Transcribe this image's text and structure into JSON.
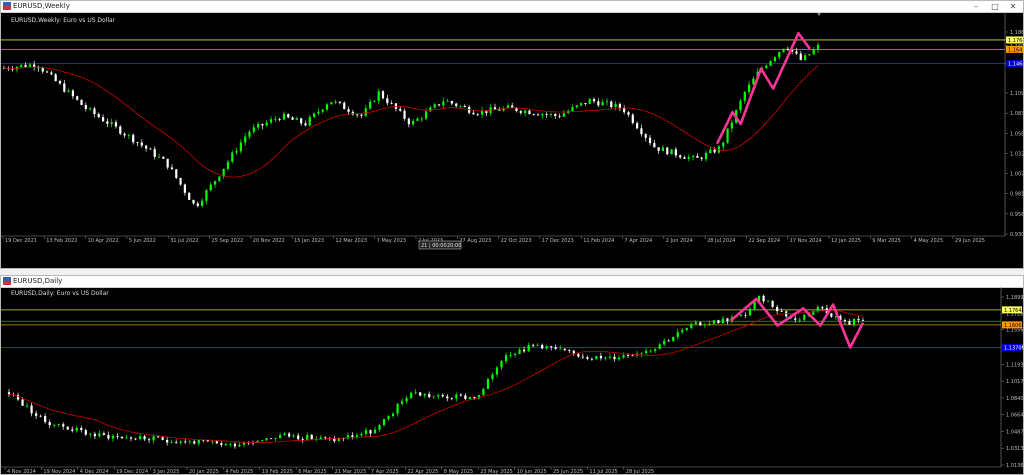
{
  "weekly": {
    "window_title": "EURUSD,Weekly",
    "chart_title": "EURUSD,Weekly: Euro vs US Dollar",
    "price_labels": [
      "1.18650",
      "1.17643",
      "1.16900",
      "1.14645",
      "1.10920",
      "1.08370",
      "1.05820",
      "1.03270",
      "1.00720",
      "0.98170",
      "0.95620",
      "0.93070"
    ],
    "price_values": [
      1.1865,
      1.17643,
      1.169,
      1.14645,
      1.1092,
      1.0837,
      1.0582,
      1.0327,
      1.0072,
      0.9817,
      0.9562,
      0.9307
    ],
    "tag_labels": [
      {
        "text": "1.17643",
        "value": 1.17643,
        "bg": "#ffff66",
        "fg": "#000000"
      },
      {
        "text": "1.16450",
        "value": 1.1645,
        "bg": "#ff9900",
        "fg": "#000000"
      },
      {
        "text": "1.14645",
        "value": 1.14645,
        "bg": "#0000cc",
        "fg": "#ffffff"
      }
    ],
    "date_labels": [
      "19 Dec 2021",
      "13 Feb 2022",
      "10 Apr 2022",
      "5 Jun 2022",
      "31 Jul 2022",
      "25 Sep 2022",
      "20 Nov 2022",
      "15 Jan 2023",
      "12 Mar 2023",
      "7 May 2023",
      "2 Jul 2023",
      "27 Aug 2023",
      "22 Oct 2023",
      "17 Dec 2023",
      "11 Feb 2024",
      "7 Apr 2024",
      "2 Jun 2024",
      "28 Jul 2024",
      "22 Sep 2024",
      "17 Nov 2024",
      "12 Jan 2025",
      "9 Mar 2025",
      "4 May 2025",
      "29 Jun 2025"
    ],
    "crosshair_labels": [
      "21 | 00:00",
      "20:00"
    ],
    "hlines": [
      {
        "value": 1.17643,
        "color": "#d8d850"
      },
      {
        "value": 1.1645,
        "color": "#d89a20"
      },
      {
        "value": 1.14645,
        "color": "#2f3fa0"
      }
    ]
  },
  "daily": {
    "window_title": "EURUSD,Daily",
    "chart_title": "EURUSD,Daily: Euro vs US Dollar",
    "price_labels": [
      "1.18995",
      "1.17280",
      "1.15565",
      "1.13850",
      "1.11935",
      "1.10170",
      "1.08405",
      "1.06640",
      "1.04875",
      "1.03130",
      "1.01365"
    ],
    "price_values": [
      1.18995,
      1.1728,
      1.15565,
      1.1385,
      1.11935,
      1.1017,
      1.08405,
      1.0664,
      1.04875,
      1.0313,
      1.01365
    ],
    "tag_labels": [
      {
        "text": "1.17643",
        "value": 1.17643,
        "bg": "#ffff66",
        "fg": "#000000"
      },
      {
        "text": "1.16068",
        "value": 1.16068,
        "bg": "#ff9900",
        "fg": "#000000"
      },
      {
        "text": "1.13700",
        "value": 1.137,
        "bg": "#0000cc",
        "fg": "#ffffff"
      }
    ],
    "date_labels": [
      "4 Nov 2024",
      "19 Nov 2024",
      "4 Dec 2024",
      "19 Dec 2024",
      "3 Jan 2025",
      "20 Jan 2025",
      "4 Feb 2025",
      "19 Feb 2025",
      "6 Mar 2025",
      "21 Mar 2025",
      "7 Apr 2025",
      "22 Apr 2025",
      "8 May 2025",
      "23 May 2025",
      "10 Jun 2025",
      "25 Jun 2025",
      "11 Jul 2025",
      "28 Jul 2025"
    ],
    "hlines": [
      {
        "value": 1.17643,
        "color": "#d8d850"
      },
      {
        "value": 1.1645,
        "color": "#2aa02a"
      },
      {
        "value": 1.16068,
        "color": "#d89a20"
      },
      {
        "value": 1.137,
        "color": "#2f3fa0"
      }
    ]
  },
  "colors": {
    "background": "#000000",
    "bull": "#00ff00",
    "bear": "#ffffff",
    "moving_average": "#cc0000",
    "zigzag": "#ff3399"
  },
  "icons": {
    "window": "flag-icon",
    "minimize": "minimize-icon",
    "maximize": "maximize-icon",
    "close": "close-icon"
  }
}
